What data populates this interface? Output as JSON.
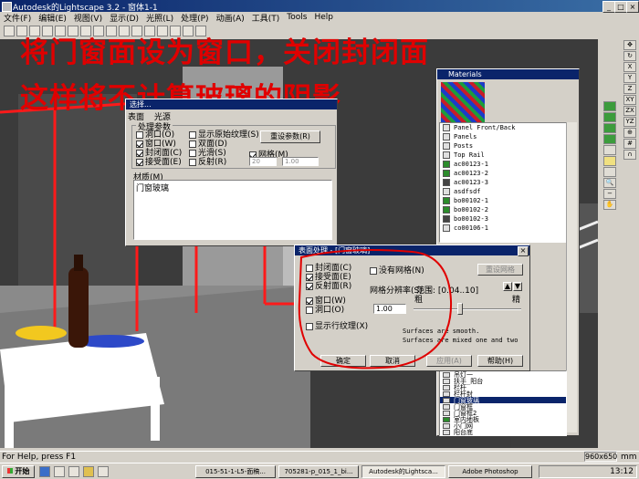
{
  "window": {
    "title": "Autodesk的Lightscape 3.2 - 窗体1-1"
  },
  "menu": [
    "文件(F)",
    "编辑(E)",
    "视图(V)",
    "显示(D)",
    "光照(L)",
    "处理(P)",
    "动画(A)",
    "工具(T)",
    "Tools",
    "Help"
  ],
  "overlay": {
    "line1": "将门窗面设为窗口，关闭封闭面",
    "line2": "这样将不计算玻璃的阴影"
  },
  "materials": {
    "title": "Materials",
    "items": [
      "Panel Front/Back",
      "Panels",
      "Posts",
      "Top Rail",
      "ac00123-1",
      "ac00123-2",
      "ac00123-3",
      "asdfsdf",
      "bo00102-1",
      "bo00102-2",
      "bo00102-3",
      "co00106-1"
    ],
    "lower_items": [
      "吊灯一",
      "扶手_阳台",
      "栏杆",
      "栏杆封",
      "门窗玻璃",
      "门窗框",
      "门窗框2",
      "室内地板",
      "小门网",
      "阳台底"
    ],
    "selected": "门窗玻璃"
  },
  "back_dialog": {
    "title": "选择...",
    "tabs": [
      "表面",
      "光源"
    ],
    "group_title": "处理参数",
    "col1": [
      {
        "label": "洞口(O)",
        "checked": false
      },
      {
        "label": "窗口(W)",
        "checked": true
      },
      {
        "label": "封闭面(C)",
        "checked": true
      },
      {
        "label": "接受面(E)",
        "checked": true
      }
    ],
    "col2": [
      {
        "label": "显示原始纹理(S)",
        "checked": false
      },
      {
        "label": "双面(D)",
        "checked": false
      },
      {
        "label": "光滑(S)",
        "checked": false
      },
      {
        "label": "反射(R)",
        "checked": false
      }
    ],
    "reset_label": "重设参数(R)",
    "mesh_label": "网格(M)",
    "mesh_select": "20",
    "mesh_value": "1.00",
    "material_label": "材质(M)",
    "material_value": "门窗玻璃"
  },
  "front_dialog": {
    "title": "表面处理 - [门窗玻璃]",
    "checks": [
      {
        "label": "封闭面(C)",
        "checked": false
      },
      {
        "label": "接受面(E)",
        "checked": true
      },
      {
        "label": "反射面(R)",
        "checked": true
      },
      {
        "label": "窗口(W)",
        "checked": true
      },
      {
        "label": "洞口(O)",
        "checked": false
      },
      {
        "label": "显示行纹理(X)",
        "checked": false
      }
    ],
    "no_mesh_label": "没有网格(N)",
    "reset_mesh_label": "重设网格",
    "mesh_res_label": "网格分辨率(S)",
    "range_label": "范围: [0.04..10]",
    "coarse": "粗",
    "fine": "精",
    "mesh_value": "1.00",
    "note1": "Surfaces are smooth.",
    "note2": "Surfaces are mixed one and two",
    "ok": "确定",
    "cancel": "取消",
    "apply": "应用(A)",
    "help": "帮助(H)"
  },
  "right_tools": [
    "X",
    "Y",
    "Z",
    "XY",
    "ZX",
    "YZ"
  ],
  "status": {
    "left": "For Help, press F1",
    "right": "960x650",
    "unit": "mm"
  },
  "taskbar": {
    "start": "开始",
    "items": [
      "015-51-1-L5-面稿...",
      "705281-p_015_1_bi...",
      "Autodesk的Lightsca...",
      "Adobe Photoshop"
    ],
    "clock": "13:12"
  },
  "colors": {
    "accent": "#0a246a",
    "annotation": "#e00000",
    "viewport_bg": "#3a3a3a"
  }
}
